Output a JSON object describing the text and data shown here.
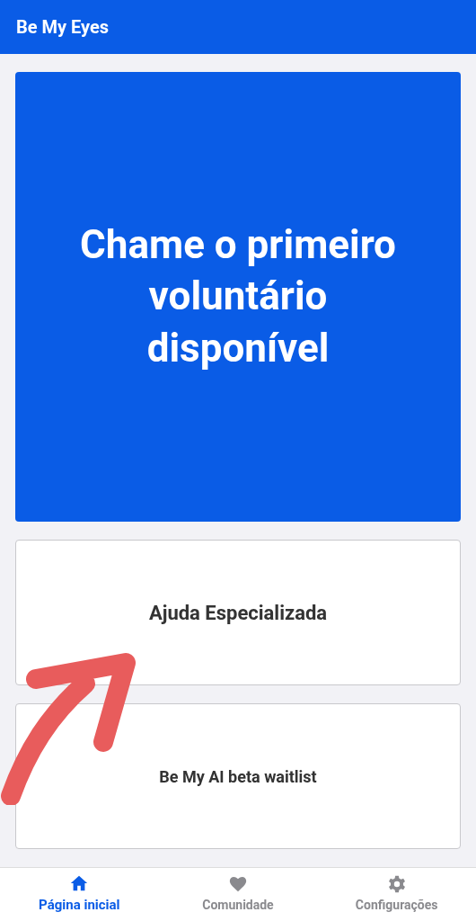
{
  "app_bar": {
    "title": "Be My Eyes"
  },
  "actions": [
    {
      "kind": "primary",
      "label": "Chame o primeiro voluntário disponível"
    },
    {
      "kind": "secondary",
      "label": "Ajuda Especializada"
    },
    {
      "kind": "small",
      "label": "Be My AI beta waitlist"
    }
  ],
  "nav": [
    {
      "kind": "home",
      "label": "Página inicial",
      "selected": true
    },
    {
      "kind": "heart",
      "label": "Comunidade",
      "selected": false
    },
    {
      "kind": "gear",
      "label": "Configurações",
      "selected": false
    }
  ]
}
